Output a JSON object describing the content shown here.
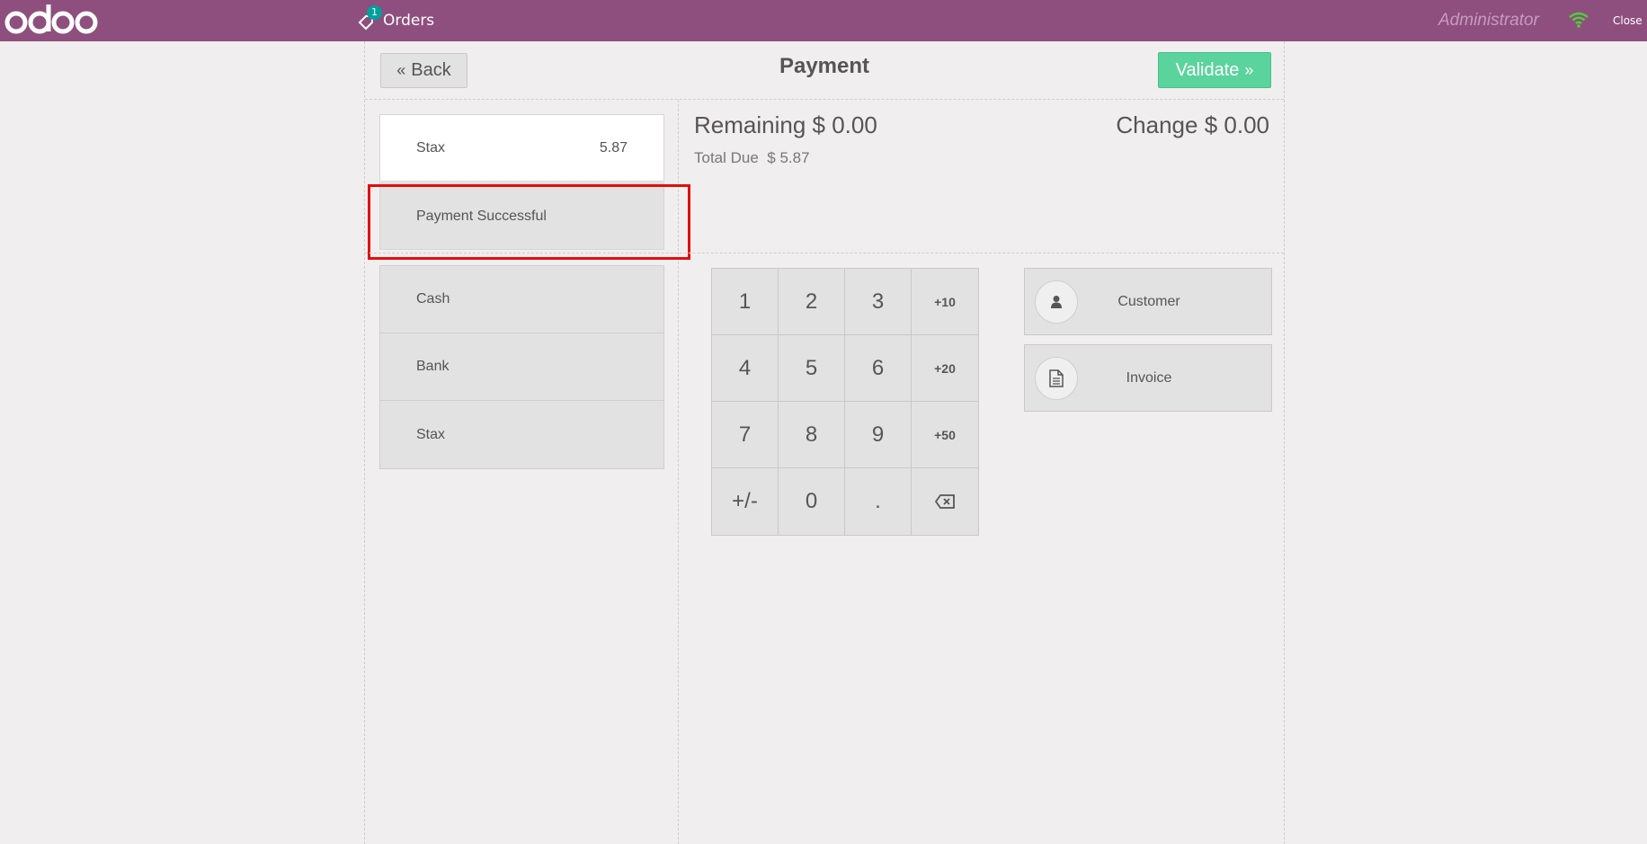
{
  "topbar": {
    "logo": "odoo",
    "orders_label": "Orders",
    "orders_badge": "1",
    "user": "Administrator",
    "close_label": "Close",
    "wifi_color": "#4cd137"
  },
  "header": {
    "back_label": "Back",
    "title": "Payment",
    "validate_label": "Validate"
  },
  "payment_line": {
    "method": "Stax",
    "amount": "5.87",
    "status": "Payment Successful"
  },
  "summary": {
    "remaining_label": "Remaining",
    "remaining_value": "$ 0.00",
    "change_label": "Change",
    "change_value": "$ 0.00",
    "total_due_label": "Total Due",
    "total_due_value": "$ 5.87"
  },
  "methods": [
    "Cash",
    "Bank",
    "Stax"
  ],
  "numpad": [
    "1",
    "2",
    "3",
    "+10",
    "4",
    "5",
    "6",
    "+20",
    "7",
    "8",
    "9",
    "+50",
    "+/-",
    "0",
    "."
  ],
  "side_buttons": {
    "customer_label": "Customer",
    "invoice_label": "Invoice"
  },
  "colors": {
    "topbar": "#8e4f7e",
    "validate": "#5bd39c",
    "highlight": "#e30d0d"
  }
}
